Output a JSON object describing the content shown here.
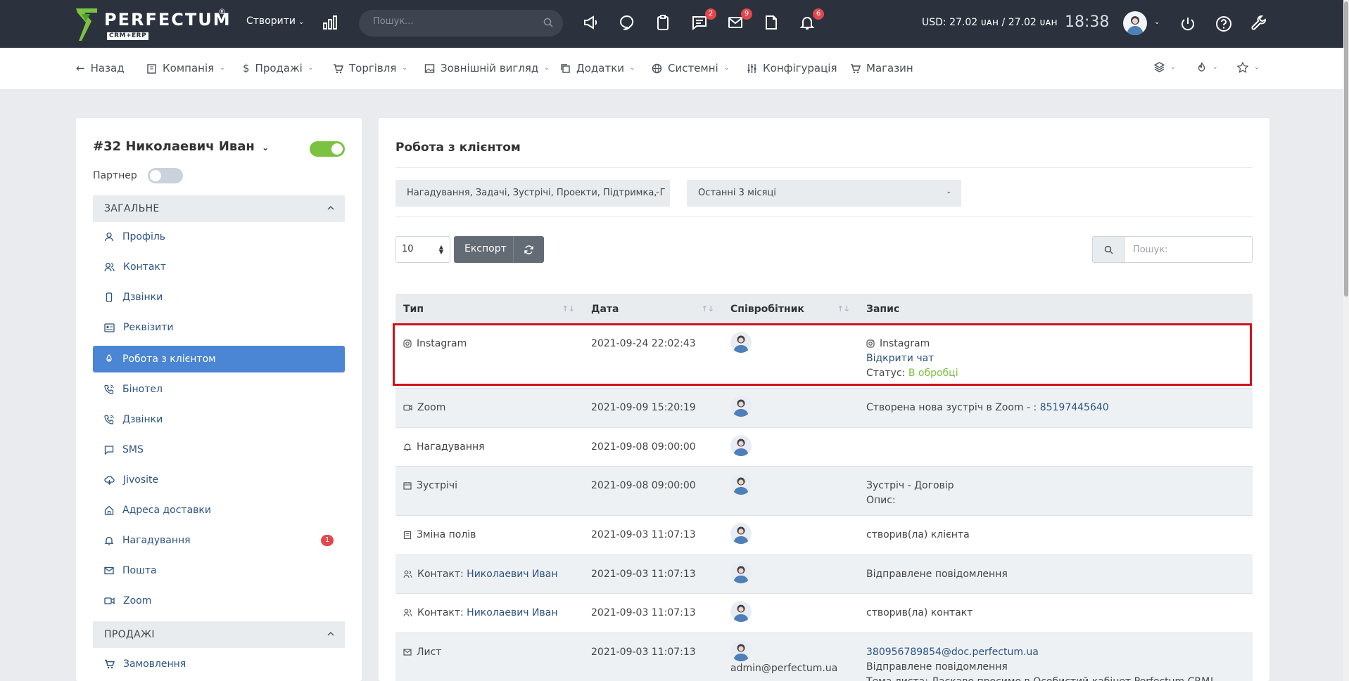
{
  "topbar": {
    "logo_text": "PERFECTUM",
    "logo_reg": "®",
    "logo_sub": "CRM+ERP",
    "create_label": "Створити",
    "search_placeholder": "Пошук...",
    "icons": [
      {
        "name": "megaphone-icon",
        "badge": ""
      },
      {
        "name": "chat-bubble-icon",
        "badge": ""
      },
      {
        "name": "clipboard-icon",
        "badge": ""
      },
      {
        "name": "messages-icon",
        "badge": "2"
      },
      {
        "name": "mail-icon",
        "badge": "9"
      },
      {
        "name": "document-icon",
        "badge": ""
      },
      {
        "name": "bell-icon",
        "badge": "6"
      }
    ],
    "currency": "USD: 27.02 ᴜᴀʜ / 27.02 ᴜᴀʜ",
    "time": "18:38"
  },
  "nav": {
    "back": "Назад",
    "company": "Компанія",
    "sales": "Продажі",
    "trade": "Торгівля",
    "appearance": "Зовнішній вигляд",
    "addons": "Додатки",
    "system": "Системні",
    "config": "Конфігурація",
    "shop": "Магазин"
  },
  "client": {
    "title": "#32 Николаевич Иван",
    "partner_label": "Партнер",
    "section_general": "ЗАГАЛЬНЕ",
    "section_sales": "ПРОДАЖІ",
    "menu": [
      {
        "label": "Профіль",
        "icon": "user-icon"
      },
      {
        "label": "Контакт",
        "icon": "users-icon"
      },
      {
        "label": "Дзвінки",
        "icon": "phone-icon"
      },
      {
        "label": "Реквізити",
        "icon": "id-card-icon"
      },
      {
        "label": "Робота з клієнтом",
        "icon": "handshake-icon",
        "active": true
      },
      {
        "label": "Бінотел",
        "icon": "phone-call-icon"
      },
      {
        "label": "Дзвінки",
        "icon": "phone-call-icon"
      },
      {
        "label": "SMS",
        "icon": "sms-icon"
      },
      {
        "label": "Jivosite",
        "icon": "cloud-icon"
      },
      {
        "label": "Адреса доставки",
        "icon": "home-icon"
      },
      {
        "label": "Нагадування",
        "icon": "bell-icon",
        "badge": "1"
      },
      {
        "label": "Пошта",
        "icon": "envelope-icon"
      },
      {
        "label": "Zoom",
        "icon": "video-icon"
      }
    ],
    "sales_menu": [
      {
        "label": "Замовлення",
        "icon": "cart-icon"
      }
    ]
  },
  "main": {
    "title": "Робота з клієнтом",
    "filter_types": "Нагадування, Задачі, Зустрічі, Проекти, Підтримка, Г",
    "filter_period": "Останні 3 місяці",
    "page_size": "10",
    "export_label": "Експорт",
    "search_placeholder": "Пошук:",
    "columns": [
      "Тип",
      "Дата",
      "Співробітник",
      "Запис"
    ],
    "rows": [
      {
        "type": "Instagram",
        "type_icon": "instagram-icon",
        "date": "2021-09-24 22:02:43",
        "employee": "",
        "rec1": "Instagram",
        "rec2": "Відкрити чат",
        "rec3_label": "Статус:",
        "rec3_value": "В обробці"
      },
      {
        "type": "Zoom",
        "type_icon": "video-icon",
        "date": "2021-09-09 15:20:19",
        "employee": "",
        "rec1": "Створена нова зустріч в Zoom - : ",
        "rec1_link": "85197445640"
      },
      {
        "type": "Нагадування",
        "type_icon": "bell-icon",
        "date": "2021-09-08 09:00:00",
        "employee": "",
        "rec1": ""
      },
      {
        "type": "Зустрічі",
        "type_icon": "calendar-icon",
        "date": "2021-09-08 09:00:00",
        "employee": "",
        "rec1": "Зустріч - Договір",
        "rec2": "Опис:"
      },
      {
        "type": "Зміна полів",
        "type_icon": "clipboard-icon",
        "date": "2021-09-03 11:07:13",
        "employee": "",
        "rec1": "створив(ла) клієнта"
      },
      {
        "type": "Контакт: ",
        "type_link": "Николаевич Иван",
        "type_icon": "users-icon",
        "date": "2021-09-03 11:07:13",
        "employee": "",
        "rec1": "Відправлене повідомлення"
      },
      {
        "type": "Контакт: ",
        "type_link": "Николаевич Иван",
        "type_icon": "users-icon",
        "date": "2021-09-03 11:07:13",
        "employee": "",
        "rec1": "створив(ла) контакт"
      },
      {
        "type": "Лист",
        "type_icon": "envelope-icon",
        "date": "2021-09-03 11:07:13",
        "employee": "admin@perfectum.ua",
        "rec1_link": "380956789854@doc.perfectum.ua",
        "rec2": "Відправлене повідомлення",
        "rec3": "Тема листа: Ласкаво просимо в Особистий кабінет Perfectum CRM!"
      }
    ]
  },
  "colors": {
    "topbar": "#2b323d",
    "accent": "#4a86d4",
    "toggle_on": "#7cc242",
    "badge": "#e2474d",
    "highlight": "#d0121b"
  }
}
